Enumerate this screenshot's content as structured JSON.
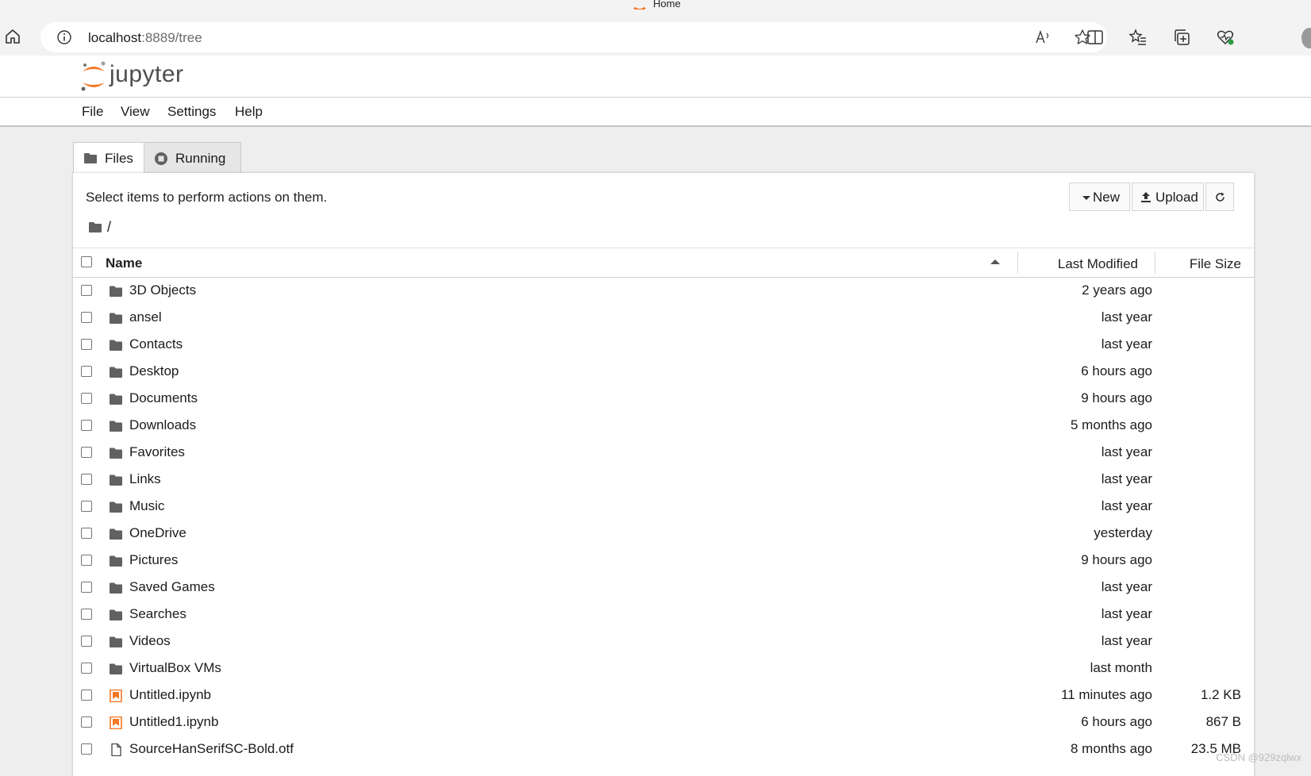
{
  "browser": {
    "tab_title": "Home",
    "url_host": "localhost",
    "url_rest": ":8889/tree"
  },
  "jupyter": {
    "brand": "jupyter",
    "menu": [
      "File",
      "View",
      "Settings",
      "Help"
    ],
    "tabs": [
      {
        "label": "Files",
        "icon": "folder-icon",
        "active": true
      },
      {
        "label": "Running",
        "icon": "stop-circle-icon",
        "active": false
      }
    ],
    "hint": "Select items to perform actions on them.",
    "buttons": {
      "new": "New",
      "upload": "Upload"
    },
    "breadcrumb": "/",
    "columns": {
      "name": "Name",
      "modified": "Last Modified",
      "size": "File Size"
    }
  },
  "files": [
    {
      "name": "3D Objects",
      "type": "folder",
      "modified": "2 years ago",
      "size": ""
    },
    {
      "name": "ansel",
      "type": "folder",
      "modified": "last year",
      "size": ""
    },
    {
      "name": "Contacts",
      "type": "folder",
      "modified": "last year",
      "size": ""
    },
    {
      "name": "Desktop",
      "type": "folder",
      "modified": "6 hours ago",
      "size": ""
    },
    {
      "name": "Documents",
      "type": "folder",
      "modified": "9 hours ago",
      "size": ""
    },
    {
      "name": "Downloads",
      "type": "folder",
      "modified": "5 months ago",
      "size": ""
    },
    {
      "name": "Favorites",
      "type": "folder",
      "modified": "last year",
      "size": ""
    },
    {
      "name": "Links",
      "type": "folder",
      "modified": "last year",
      "size": ""
    },
    {
      "name": "Music",
      "type": "folder",
      "modified": "last year",
      "size": ""
    },
    {
      "name": "OneDrive",
      "type": "folder",
      "modified": "yesterday",
      "size": ""
    },
    {
      "name": "Pictures",
      "type": "folder",
      "modified": "9 hours ago",
      "size": ""
    },
    {
      "name": "Saved Games",
      "type": "folder",
      "modified": "last year",
      "size": ""
    },
    {
      "name": "Searches",
      "type": "folder",
      "modified": "last year",
      "size": ""
    },
    {
      "name": "Videos",
      "type": "folder",
      "modified": "last year",
      "size": ""
    },
    {
      "name": "VirtualBox VMs",
      "type": "folder",
      "modified": "last month",
      "size": ""
    },
    {
      "name": "Untitled.ipynb",
      "type": "notebook",
      "modified": "11 minutes ago",
      "size": "1.2 KB"
    },
    {
      "name": "Untitled1.ipynb",
      "type": "notebook",
      "modified": "6 hours ago",
      "size": "867 B"
    },
    {
      "name": "SourceHanSerifSC-Bold.otf",
      "type": "file",
      "modified": "8 months ago",
      "size": "23.5 MB"
    }
  ],
  "watermark": "CSDN @929zqlwx",
  "colors": {
    "accent": "#f37726",
    "folder": "#616161"
  }
}
